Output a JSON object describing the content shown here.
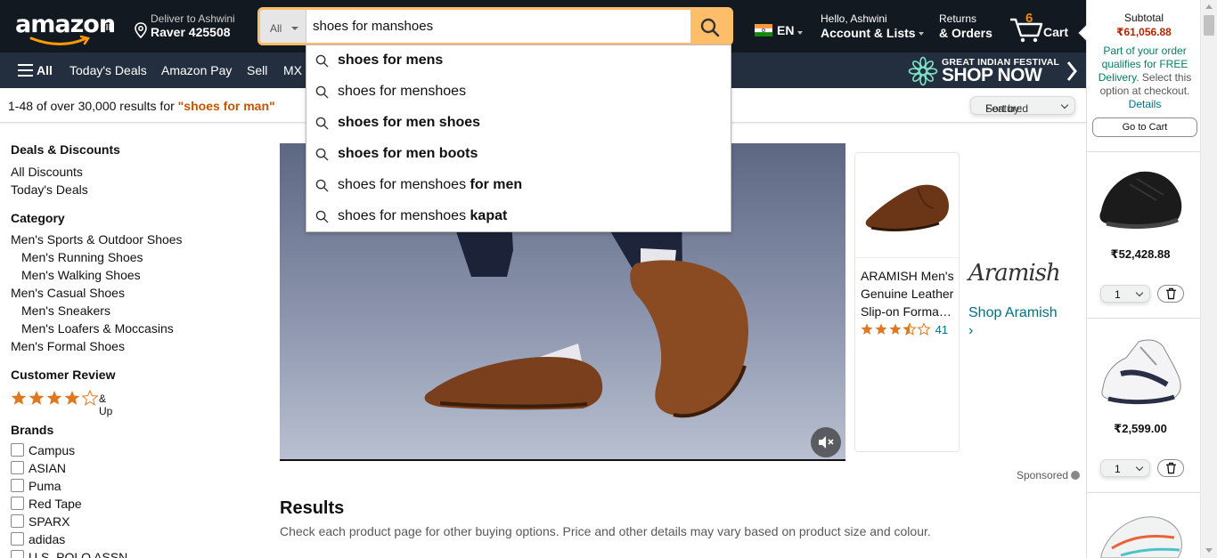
{
  "header": {
    "logo_text": "amazon",
    "logo_suffix": ".in",
    "deliver_line1": "Deliver to Ashwini",
    "deliver_line2": "Raver 425508",
    "search_dept": "All",
    "search_value": "shoes for manshoes",
    "lang_code": "EN",
    "account_line1": "Hello, Ashwini",
    "account_line2": "Account & Lists",
    "returns_line1": "Returns",
    "returns_line2": "& Orders",
    "cart_count": "6",
    "cart_label": "Cart"
  },
  "nav": {
    "all_label": "All",
    "items": [
      "Today's Deals",
      "Amazon Pay",
      "Sell",
      "MX"
    ],
    "festival_line1": "GREAT INDIAN FESTIVAL",
    "festival_line2": "SHOP NOW"
  },
  "results_bar": {
    "prefix": "1-48 of over 30,000 results for ",
    "query": "\"shoes for man\"",
    "sort_label": "Sort by:",
    "sort_value": "Featured"
  },
  "autocomplete": [
    {
      "plain": "",
      "bold": "shoes for mens"
    },
    {
      "plain": "shoes for menshoes",
      "bold": ""
    },
    {
      "plain": "",
      "bold": "shoes for men shoes"
    },
    {
      "plain": "",
      "bold": "shoes for men boots"
    },
    {
      "plain": "shoes for menshoes ",
      "bold": "for men"
    },
    {
      "plain": "shoes for menshoes ",
      "bold": "kapat"
    }
  ],
  "sidebar": {
    "deals_heading": "Deals & Discounts",
    "deals": [
      "All Discounts",
      "Today's Deals"
    ],
    "category_heading": "Category",
    "categories": [
      "Men's Sports & Outdoor Shoes",
      "Men's Running Shoes",
      "Men's Walking Shoes",
      "Men's Casual Shoes",
      "Men's Sneakers",
      "Men's Loafers & Moccasins",
      "Men's Formal Shoes"
    ],
    "review_heading": "Customer Review",
    "review_rating": 4,
    "review_suffix": "& Up",
    "brands_heading": "Brands",
    "brands": [
      "Campus",
      "ASIAN",
      "Puma",
      "Red Tape",
      "SPARX",
      "adidas",
      "U.S. POLO ASSN."
    ]
  },
  "sponsored_card": {
    "title": "ARAMISH Men's Genuine Leather Slip-on Forma…",
    "rating": 3.5,
    "rating_count": "41",
    "brand_logo": "Aramish",
    "shop_link": "Shop Aramish",
    "shop_chevron": "›",
    "sponsored_label": "Sponsored"
  },
  "results": {
    "heading": "Results",
    "subtext": "Check each product page for other buying options. Price and other details may vary based on product size and colour."
  },
  "cart_panel": {
    "subtotal_label": "Subtotal",
    "subtotal_amount": "₹61,056.88",
    "free_delivery_green": "Part of your order qualifies for FREE Delivery.",
    "free_delivery_dark": "Select this option at checkout.",
    "details_link": "Details",
    "go_to_cart": "Go to Cart",
    "items": [
      {
        "price": "₹52,428.88",
        "qty": "1"
      },
      {
        "price": "₹2,599.00",
        "qty": "1"
      }
    ]
  },
  "colors": {
    "nav_dark": "#131921",
    "nav_secondary": "#232f3e",
    "search_accent": "#febd69",
    "query_orange": "#c45500",
    "price_red": "#b12704",
    "link_teal": "#007185",
    "star_orange": "#de7921"
  }
}
